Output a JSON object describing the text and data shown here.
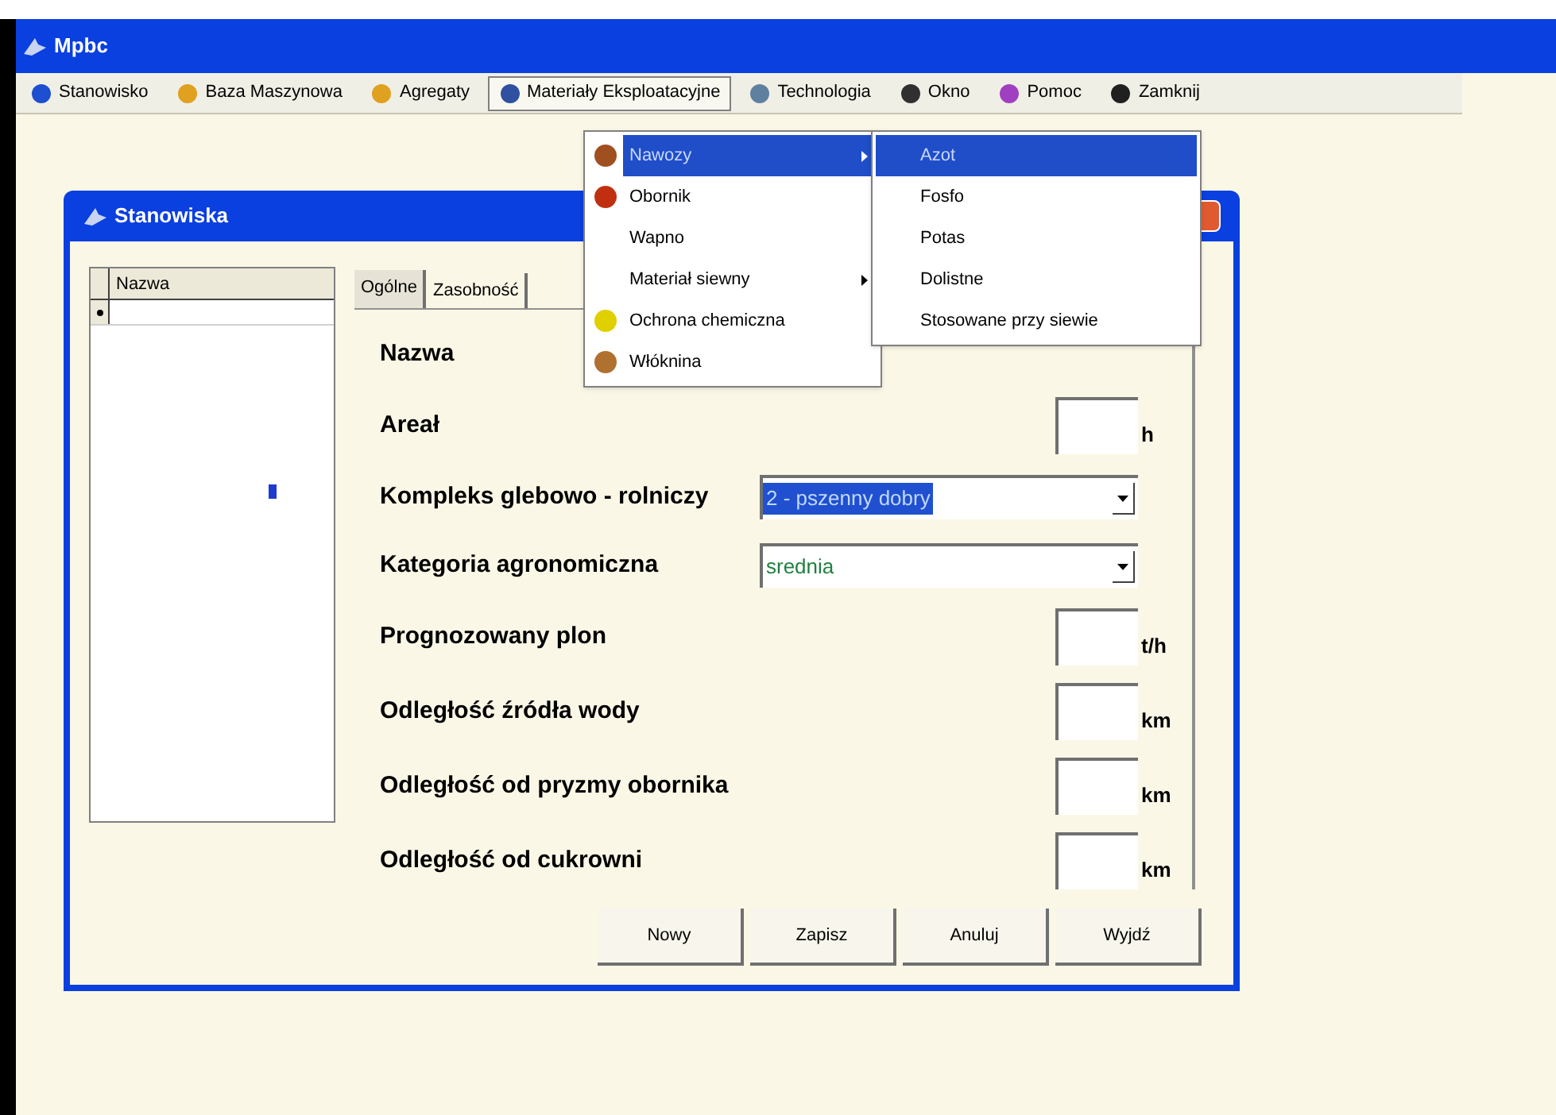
{
  "window": {
    "title": "Mpbc"
  },
  "menu_bar": [
    {
      "label": "Stanowisko",
      "selected": false
    },
    {
      "label": "Baza Maszynowa",
      "selected": false
    },
    {
      "label": "Agregaty",
      "selected": false
    },
    {
      "label": "Materiały Eksploatacyjne",
      "selected": true
    },
    {
      "label": "Technologia",
      "selected": false
    },
    {
      "label": "Okno",
      "selected": false
    },
    {
      "label": "Pomoc",
      "selected": false
    },
    {
      "label": "Zamknij",
      "selected": false
    }
  ],
  "menu": [
    {
      "label": "Nawozy",
      "selected": true,
      "submenu": true
    },
    {
      "label": "Obornik",
      "selected": false,
      "submenu": false
    },
    {
      "label": "Wapno",
      "selected": false,
      "submenu": false
    },
    {
      "label": "Materiał siewny",
      "selected": false,
      "submenu": true
    },
    {
      "label": "Ochrona chemiczna",
      "selected": false,
      "submenu": false
    },
    {
      "label": "Włóknina",
      "selected": false,
      "submenu": false
    }
  ],
  "submenu": [
    {
      "label": "Azot",
      "selected": true
    },
    {
      "label": "Fosfo",
      "selected": false
    },
    {
      "label": "Potas",
      "selected": false
    },
    {
      "label": "Dolistne",
      "selected": false
    },
    {
      "label": "Stosowane przy siewie",
      "selected": false
    }
  ],
  "dialog": {
    "title": "Stanowiska",
    "grid": {
      "column": "Nazwa"
    },
    "tabs": [
      {
        "label": "Ogólne",
        "selected": true
      },
      {
        "label": "Zasobność",
        "selected": false
      }
    ],
    "fields": [
      {
        "kind": "text",
        "label": "Nazwa"
      },
      {
        "kind": "input",
        "label": "Areał",
        "unit": "h"
      },
      {
        "kind": "combo",
        "label": "Kompleks glebowo - rolniczy",
        "value": "2 - pszenny dobry",
        "highlighted": true
      },
      {
        "kind": "combo",
        "label": "Kategoria agronomiczna",
        "value": "srednia",
        "highlighted": false
      },
      {
        "kind": "input",
        "label": "Prognozowany plon",
        "unit": "t/h"
      },
      {
        "kind": "input",
        "label": "Odległość źródła wody",
        "unit": "km"
      },
      {
        "kind": "input",
        "label": "Odległość od pryzmy obornika",
        "unit": "km"
      },
      {
        "kind": "input",
        "label": "Odległość od cukrowni",
        "unit": "km"
      }
    ],
    "buttons": [
      "Nowy",
      "Zapisz",
      "Anuluj",
      "Wyjdź"
    ]
  }
}
